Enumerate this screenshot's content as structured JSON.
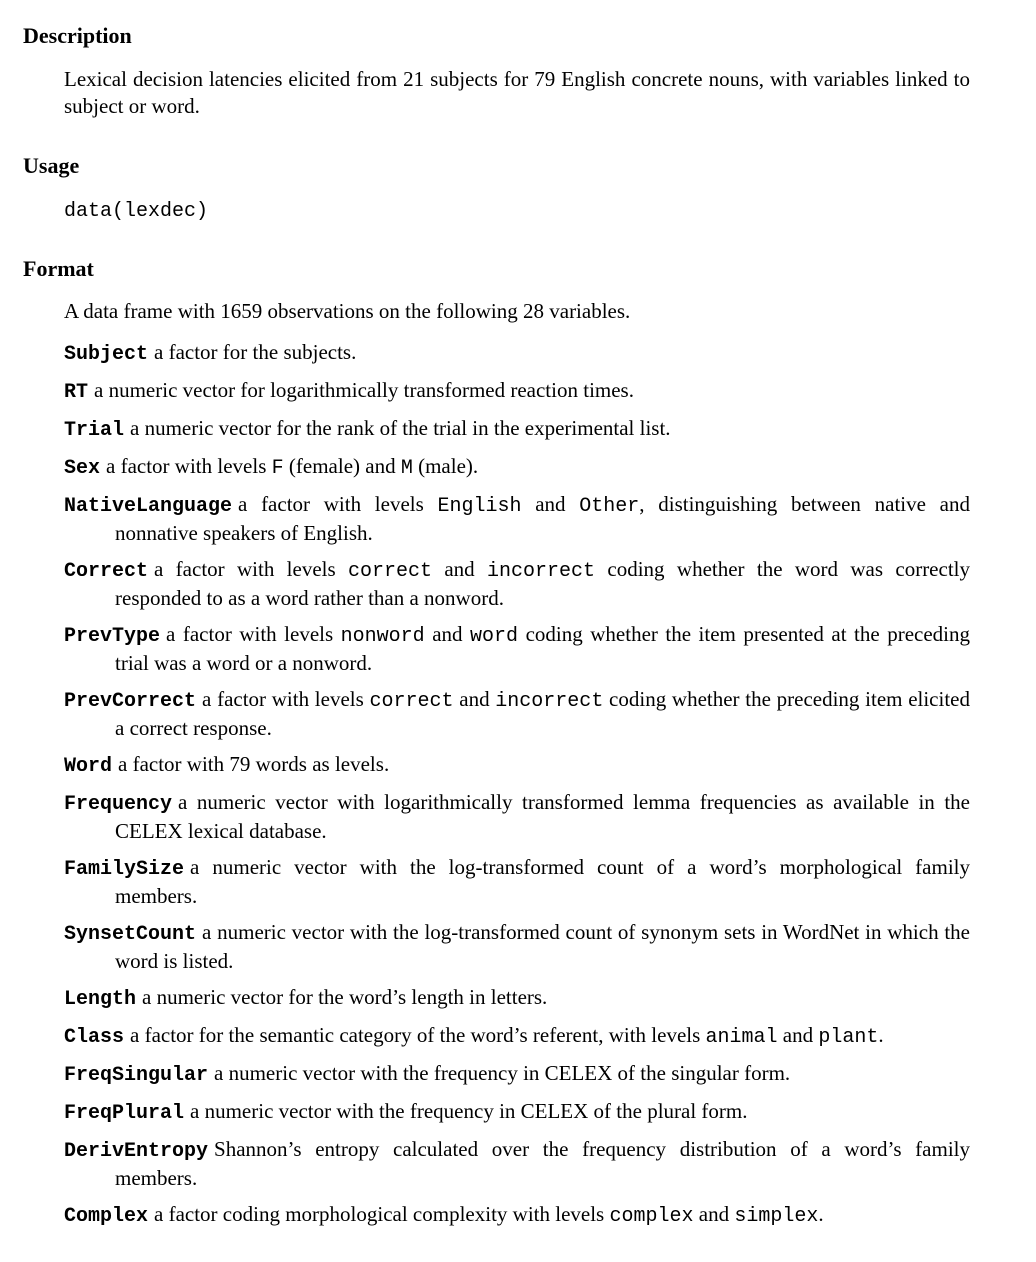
{
  "description": {
    "heading": "Description",
    "text": "Lexical decision latencies elicited from 21 subjects for 79 English concrete nouns, with variables linked to subject or word."
  },
  "usage": {
    "heading": "Usage",
    "code": "data(lexdec)"
  },
  "format": {
    "heading": "Format",
    "intro": "A data frame with 1659 observations on the following 28 variables.",
    "variables": [
      {
        "name": "Subject",
        "parts": [
          "a factor for the subjects."
        ]
      },
      {
        "name": "RT",
        "parts": [
          "a numeric vector for logarithmically transformed reaction times."
        ]
      },
      {
        "name": "Trial",
        "parts": [
          "a numeric vector for the rank of the trial in the experimental list."
        ]
      },
      {
        "name": "Sex",
        "parts": [
          "a factor with levels ",
          "F",
          " (female) and ",
          "M",
          " (male)."
        ]
      },
      {
        "name": "NativeLanguage",
        "parts": [
          "a factor with levels ",
          "English",
          " and ",
          "Other",
          ", distinguishing between native and nonnative speakers of English."
        ]
      },
      {
        "name": "Correct",
        "parts": [
          "a factor with levels ",
          "correct",
          " and ",
          "incorrect",
          " coding whether the word was correctly responded to as a word rather than a nonword."
        ]
      },
      {
        "name": "PrevType",
        "parts": [
          "a factor with levels ",
          "nonword",
          " and ",
          "word",
          " coding whether the item presented at the preceding trial was a word or a nonword."
        ]
      },
      {
        "name": "PrevCorrect",
        "parts": [
          "a factor with levels ",
          "correct",
          " and ",
          "incorrect",
          " coding whether the preceding item elicited a correct response."
        ]
      },
      {
        "name": "Word",
        "parts": [
          "a factor with 79 words as levels."
        ]
      },
      {
        "name": "Frequency",
        "parts": [
          "a numeric vector with logarithmically transformed lemma frequencies as available in the CELEX lexical database."
        ]
      },
      {
        "name": "FamilySize",
        "parts": [
          "a numeric vector with the log-transformed count of a word’s morphological family members."
        ]
      },
      {
        "name": "SynsetCount",
        "parts": [
          "a numeric vector with the log-transformed count of synonym sets in WordNet in which the word is listed."
        ]
      },
      {
        "name": "Length",
        "parts": [
          "a numeric vector for the word’s length in letters."
        ]
      },
      {
        "name": "Class",
        "parts": [
          "a factor for the semantic category of the word’s referent, with levels ",
          "animal",
          " and ",
          "plant",
          "."
        ]
      },
      {
        "name": "FreqSingular",
        "parts": [
          "a numeric vector with the frequency in CELEX of the singular form."
        ]
      },
      {
        "name": "FreqPlural",
        "parts": [
          "a numeric vector with the frequency in CELEX of the plural form."
        ]
      },
      {
        "name": "DerivEntropy",
        "parts": [
          "Shannon’s entropy calculated over the frequency distribution of a word’s family members."
        ]
      },
      {
        "name": "Complex",
        "parts": [
          "a factor coding morphological complexity with levels ",
          "complex",
          " and ",
          "simplex",
          "."
        ]
      }
    ]
  }
}
